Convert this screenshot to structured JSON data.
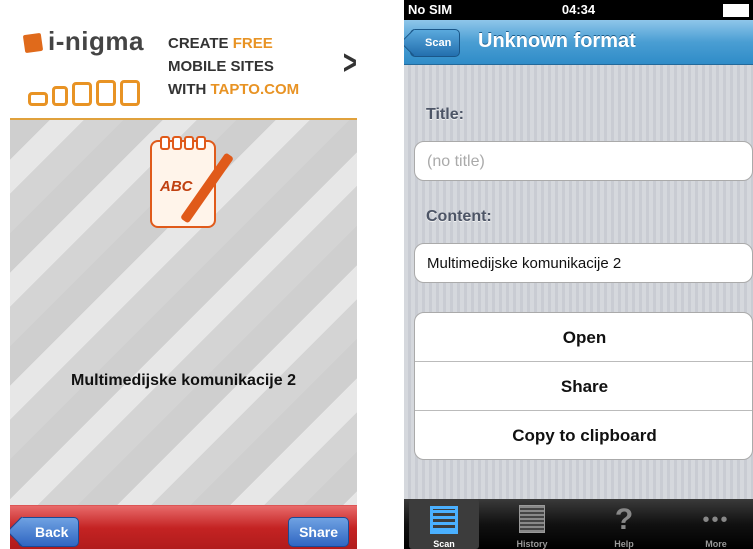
{
  "left_screen": {
    "ad": {
      "logo": "i-nigma",
      "line1": "CREATE",
      "line1_highlight": "FREE",
      "line2": "MOBILE SITES",
      "line3": "WITH",
      "line3_highlight": "TAPTO.COM",
      "accent_color": "#e89324"
    },
    "content_text": "Multimedijske komunikacije 2",
    "toolbar": {
      "back_label": "Back",
      "share_label": "Share",
      "bar_color": "#c42323"
    }
  },
  "right_screen": {
    "status_bar": {
      "carrier": "No SIM",
      "time": "04:34"
    },
    "nav": {
      "back_label": "Scan",
      "title": "Unknown format"
    },
    "title_label": "Title:",
    "title_value": "(no title)",
    "content_label": "Content:",
    "content_value": "Multimedijske komunikacije 2",
    "actions": [
      "Open",
      "Share",
      "Copy to clipboard"
    ],
    "tabs": [
      {
        "label": "Scan",
        "icon": "qr-code-icon",
        "selected": true
      },
      {
        "label": "History",
        "icon": "history-icon",
        "selected": false
      },
      {
        "label": "Help",
        "icon": "question-icon",
        "selected": false
      },
      {
        "label": "More",
        "icon": "more-icon",
        "selected": false
      }
    ]
  }
}
